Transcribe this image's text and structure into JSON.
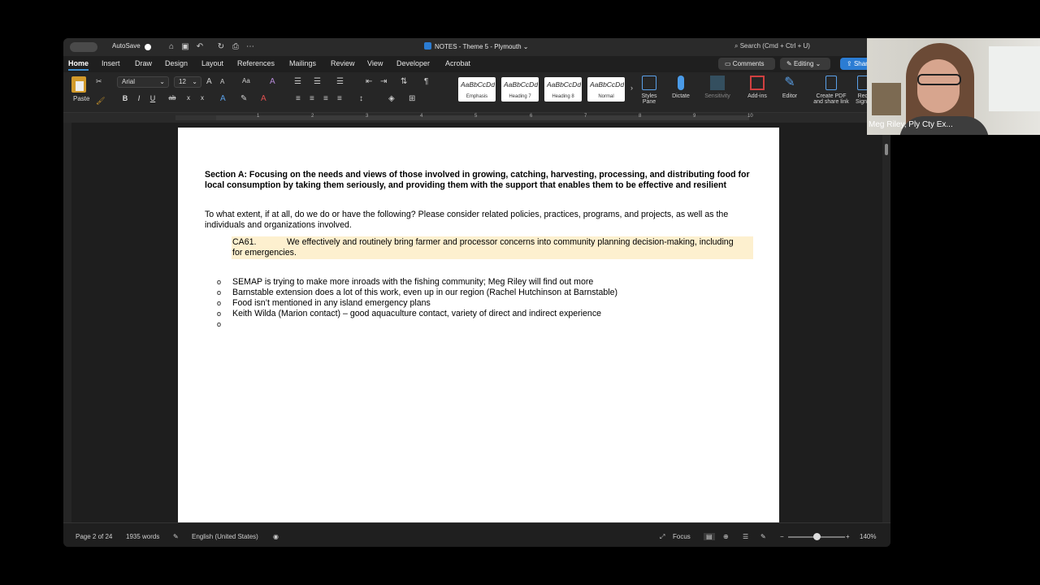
{
  "titlebar": {
    "autosave_label": "AutoSave",
    "doc_title": "NOTES - Theme 5 - Plymouth",
    "search_placeholder": "Search (Cmd + Ctrl + U)"
  },
  "tabs": [
    "Home",
    "Insert",
    "Draw",
    "Design",
    "Layout",
    "References",
    "Mailings",
    "Review",
    "View",
    "Developer",
    "Acrobat"
  ],
  "actions": {
    "comments": "Comments",
    "editing": "Editing",
    "share": "Share"
  },
  "ribbon": {
    "paste_label": "Paste",
    "font_name": "Arial",
    "font_size": "12",
    "styles": [
      {
        "sample": "AaBbCcDd",
        "name": "Emphasis"
      },
      {
        "sample": "AaBbCcDd",
        "name": "Heading 7"
      },
      {
        "sample": "AaBbCcDd",
        "name": "Heading 8"
      },
      {
        "sample": "AaBbCcDd",
        "name": "Normal"
      }
    ],
    "styles_pane_1": "Styles",
    "styles_pane_2": "Pane",
    "dictate": "Dictate",
    "sensitivity": "Sensitivity",
    "addins": "Add-ins",
    "editor": "Editor",
    "create_pdf_1": "Create PDF",
    "create_pdf_2": "and share link",
    "req_sig_1": "Req",
    "req_sig_2": "Signa"
  },
  "ruler_numbers": [
    "1",
    "2",
    "3",
    "4",
    "5",
    "6",
    "7",
    "8",
    "9",
    "10"
  ],
  "document": {
    "section_heading": "Section A: Focusing on the needs and views of those involved in growing, catching, harvesting, processing, and distributing food for local consumption by taking them seriously, and providing them with the support that enables them to be effective and resilient",
    "question": "To what extent, if at all, do we do or have the following? Please consider related policies, practices, programs, and projects, as well as the individuals and organizations involved.",
    "ca_code": "CA61.",
    "ca_text": "We effectively and routinely bring farmer and processor concerns into community planning decision-making, including for emergencies.",
    "bullet_marker": "o",
    "bullets": [
      "SEMAP is trying to make more inroads with the fishing community; Meg Riley will find out more",
      "Barnstable extension does a lot of this work, even up in our region (Rachel Hutchinson at Barnstable)",
      "Food isn’t mentioned in any island emergency plans",
      "Keith Wilda (Marion contact) – good aquaculture contact, variety of direct and indirect experience",
      ""
    ]
  },
  "status": {
    "page": "Page 2 of 24",
    "words": "1935 words",
    "language": "English (United States)",
    "focus": "Focus",
    "zoom": "140%"
  },
  "video": {
    "name": "Meg Riley, Ply Cty Ex..."
  }
}
